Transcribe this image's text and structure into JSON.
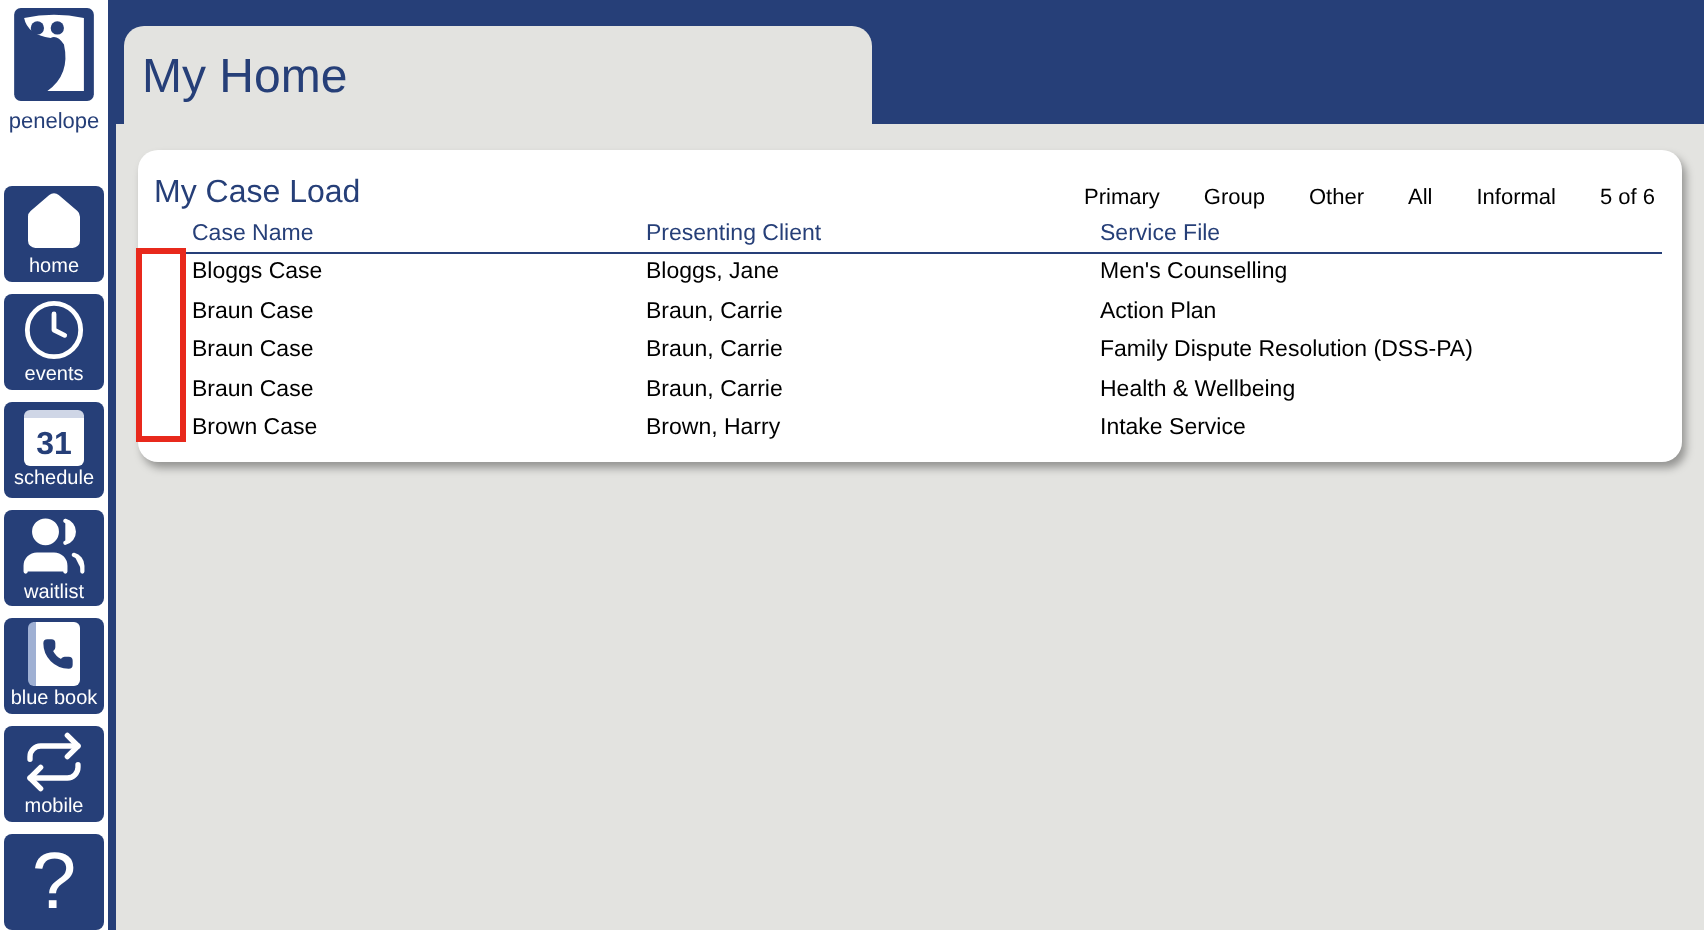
{
  "app": {
    "name": "penelope"
  },
  "nav": [
    {
      "kind": "home",
      "label": "home"
    },
    {
      "kind": "events",
      "label": "events"
    },
    {
      "kind": "schedule",
      "label": "schedule",
      "day": "31"
    },
    {
      "kind": "waitlist",
      "label": "waitlist"
    },
    {
      "kind": "bluebook",
      "label": "blue book"
    },
    {
      "kind": "mobile",
      "label": "mobile"
    },
    {
      "kind": "help",
      "glyph": "?"
    }
  ],
  "page": {
    "title": "My Home"
  },
  "case_load": {
    "title": "My Case Load",
    "filters": [
      "Primary",
      "Group",
      "Other",
      "All",
      "Informal"
    ],
    "count": "5 of 6",
    "columns": [
      "Case Name",
      "Presenting Client",
      "Service File"
    ],
    "rows": [
      [
        "Bloggs Case",
        "Bloggs, Jane",
        "Men's Counselling"
      ],
      [
        "Braun Case",
        "Braun, Carrie",
        "Action Plan"
      ],
      [
        "Braun Case",
        "Braun, Carrie",
        "Family Dispute Resolution (DSS-PA)"
      ],
      [
        "Braun Case",
        "Braun, Carrie",
        "Health & Wellbeing"
      ],
      [
        "Brown Case",
        "Brown, Harry",
        "Intake Service"
      ]
    ]
  }
}
